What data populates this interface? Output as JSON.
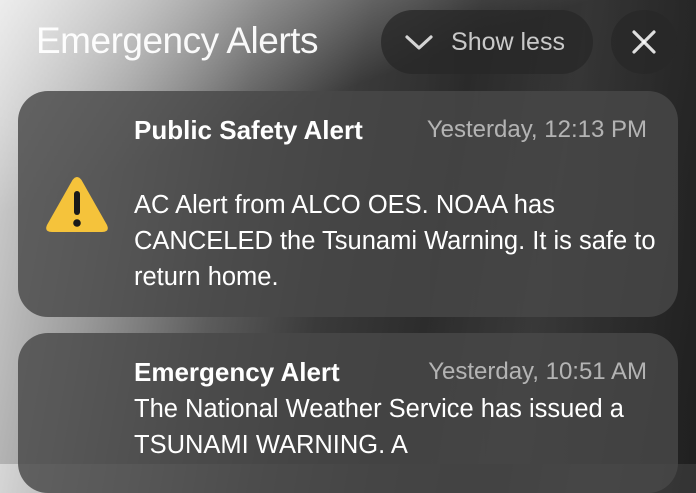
{
  "header": {
    "title": "Emergency Alerts",
    "show_less_label": "Show less",
    "show_less_icon": "chevron-down-icon",
    "close_icon": "close-icon"
  },
  "notifications": [
    {
      "title": "Public Safety Alert",
      "time": "Yesterday, 12:13 PM",
      "body": "AC Alert from ALCO OES. NOAA has CANCELED the Tsunami Warning. It is safe to return home.",
      "icon": "warning-icon",
      "icon_color": "#F5C33B"
    },
    {
      "title": "Emergency Alert",
      "time": "Yesterday, 10:51 AM",
      "body": "The National Weather Service has issued a TSUNAMI WARNING. A"
    }
  ]
}
